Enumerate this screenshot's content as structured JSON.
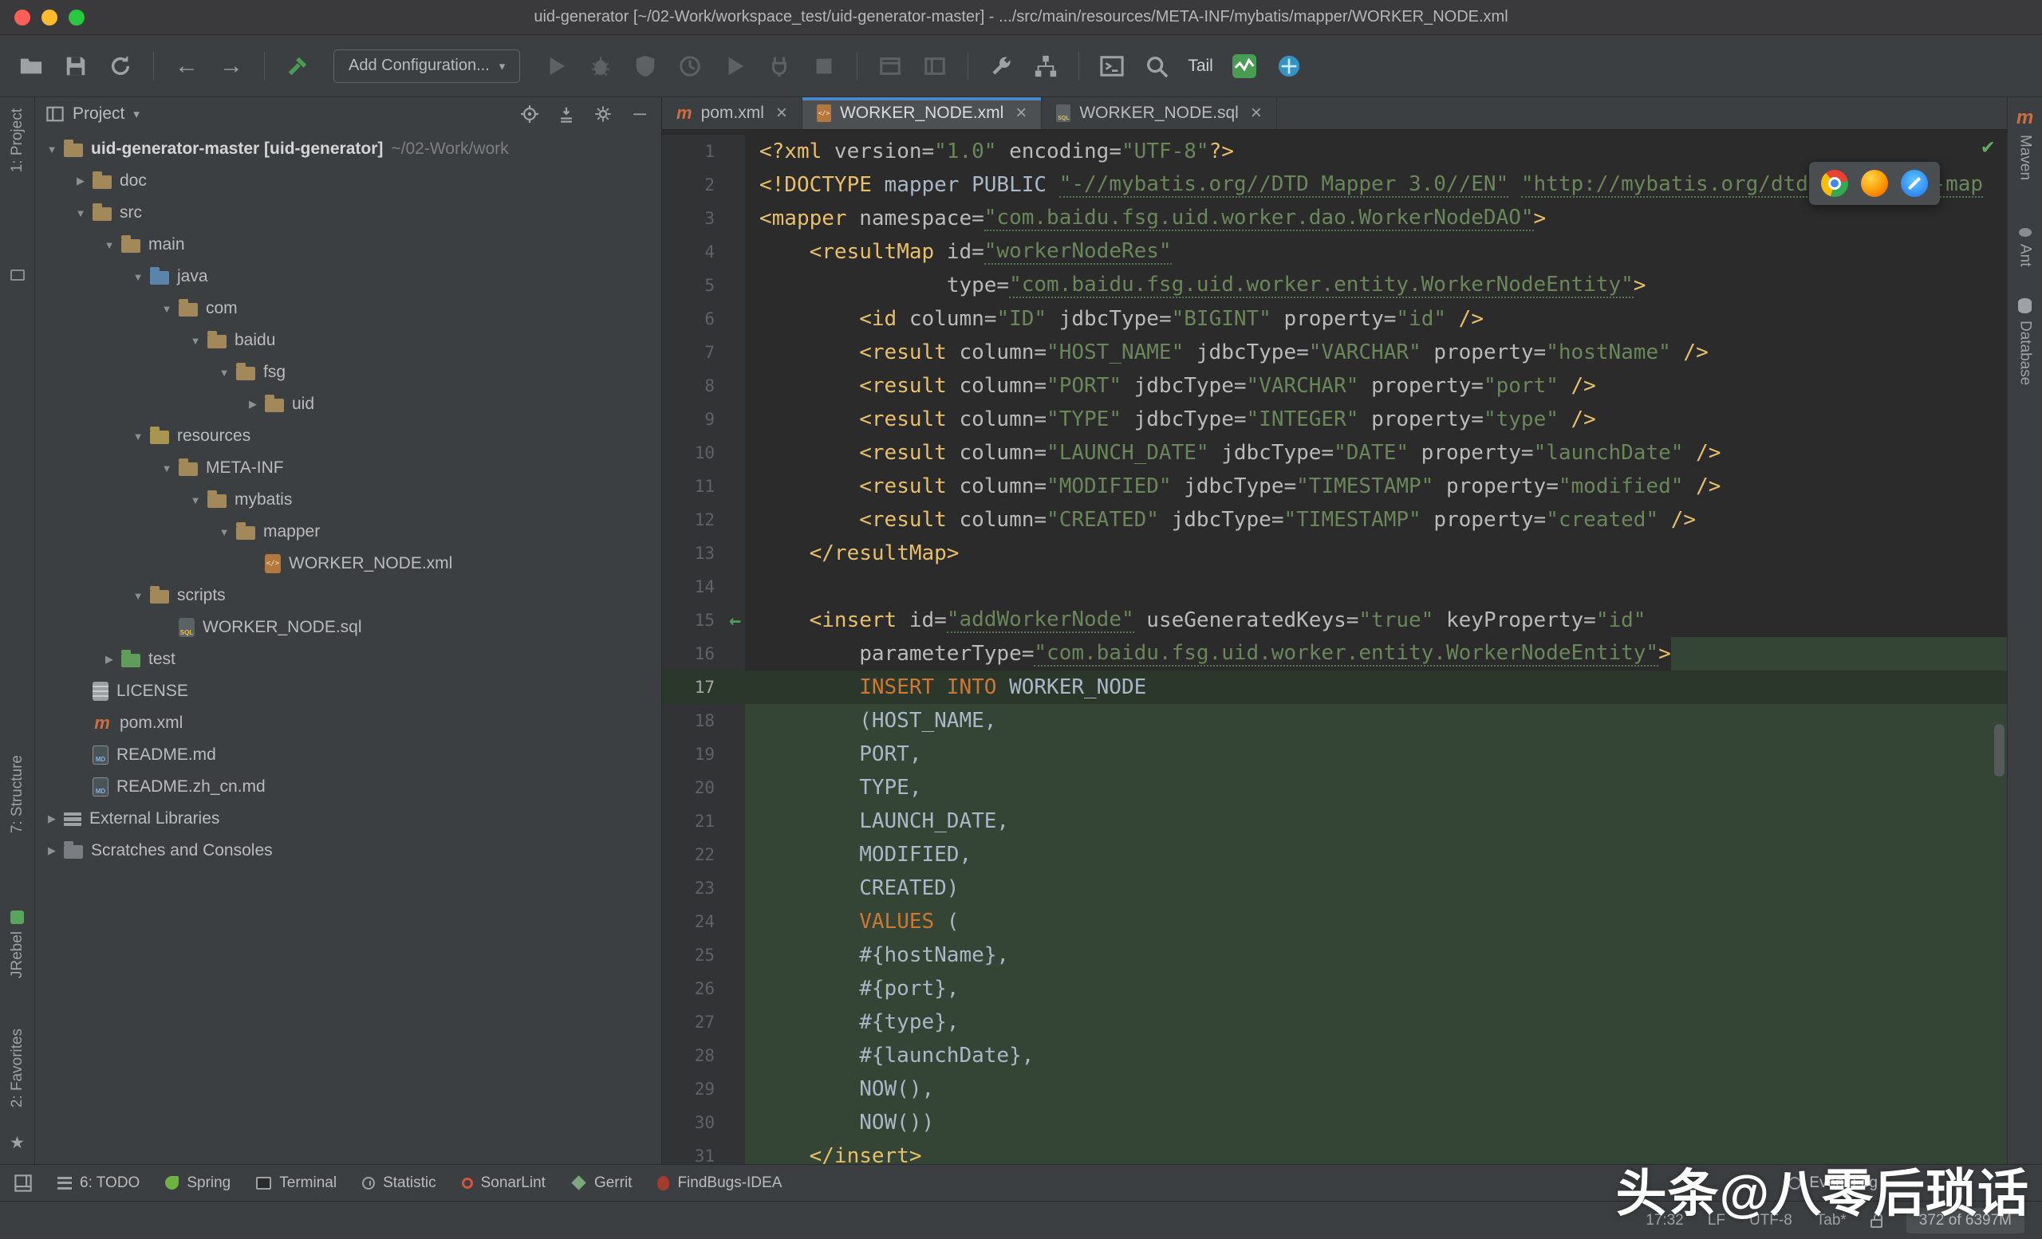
{
  "window_title": "uid-generator [~/02-Work/workspace_test/uid-generator-master] - .../src/main/resources/META-INF/mybatis/mapper/WORKER_NODE.xml",
  "toolbar": {
    "add_configuration": "Add Configuration...",
    "tail": "Tail"
  },
  "stripes": {
    "left": [
      "1: Project",
      "7: Structure",
      "JRebel",
      "2: Favorites"
    ],
    "right": [
      "Maven",
      "Ant",
      "Database"
    ]
  },
  "project_panel": {
    "title": "Project",
    "tree": [
      {
        "label": "uid-generator-master [uid-generator]",
        "suffix": "~/02-Work/work",
        "level": 0,
        "state": "expanded",
        "icon": "folder-project",
        "bold": true
      },
      {
        "label": "doc",
        "level": 1,
        "state": "collapsed",
        "icon": "folder"
      },
      {
        "label": "src",
        "level": 1,
        "state": "expanded",
        "icon": "folder"
      },
      {
        "label": "main",
        "level": 2,
        "state": "expanded",
        "icon": "folder"
      },
      {
        "label": "java",
        "level": 3,
        "state": "expanded",
        "icon": "folder-source"
      },
      {
        "label": "com",
        "level": 4,
        "state": "expanded",
        "icon": "folder"
      },
      {
        "label": "baidu",
        "level": 5,
        "state": "expanded",
        "icon": "folder"
      },
      {
        "label": "fsg",
        "level": 6,
        "state": "expanded",
        "icon": "folder"
      },
      {
        "label": "uid",
        "level": 7,
        "state": "collapsed",
        "icon": "folder"
      },
      {
        "label": "resources",
        "level": 3,
        "state": "expanded",
        "icon": "folder-resources"
      },
      {
        "label": "META-INF",
        "level": 4,
        "state": "expanded",
        "icon": "folder"
      },
      {
        "label": "mybatis",
        "level": 5,
        "state": "expanded",
        "icon": "folder"
      },
      {
        "label": "mapper",
        "level": 6,
        "state": "expanded",
        "icon": "folder"
      },
      {
        "label": "WORKER_NODE.xml",
        "level": 7,
        "state": "leaf",
        "icon": "file-xml"
      },
      {
        "label": "scripts",
        "level": 3,
        "state": "expanded",
        "icon": "folder"
      },
      {
        "label": "WORKER_NODE.sql",
        "level": 4,
        "state": "leaf",
        "icon": "file-sql"
      },
      {
        "label": "test",
        "level": 2,
        "state": "collapsed",
        "icon": "folder-test"
      },
      {
        "label": "LICENSE",
        "level": 1,
        "state": "leaf",
        "icon": "file-text"
      },
      {
        "label": "pom.xml",
        "level": 1,
        "state": "leaf",
        "icon": "file-maven"
      },
      {
        "label": "README.md",
        "level": 1,
        "state": "leaf",
        "icon": "file-md"
      },
      {
        "label": "README.zh_cn.md",
        "level": 1,
        "state": "leaf",
        "icon": "file-md"
      },
      {
        "label": "External Libraries",
        "level": 0,
        "state": "collapsed",
        "icon": "libraries"
      },
      {
        "label": "Scratches and Consoles",
        "level": 0,
        "state": "collapsed",
        "icon": "scratches"
      }
    ]
  },
  "editor": {
    "tabs": [
      {
        "label": "pom.xml",
        "icon": "maven",
        "active": false
      },
      {
        "label": "WORKER_NODE.xml",
        "icon": "xml",
        "active": true
      },
      {
        "label": "WORKER_NODE.sql",
        "icon": "sql",
        "active": false
      }
    ],
    "lines": [
      {
        "n": 1,
        "t": [
          [
            "t",
            "<?xml "
          ],
          [
            "a",
            "version="
          ],
          [
            "s",
            "\"1.0\""
          ],
          [
            "p",
            " "
          ],
          [
            "a",
            "encoding="
          ],
          [
            "s",
            "\"UTF-8\""
          ],
          [
            "t",
            "?>"
          ]
        ]
      },
      {
        "n": 2,
        "t": [
          [
            "t",
            "<!DOCTYPE "
          ],
          [
            "p",
            "mapper PUBLIC "
          ],
          [
            "su",
            "\"-//mybatis.org//DTD Mapper 3.0//EN\""
          ],
          [
            "p",
            " "
          ],
          [
            "su",
            "\"http://mybatis.org/dtd/mybatis-3-map"
          ]
        ]
      },
      {
        "n": 3,
        "t": [
          [
            "t",
            "<mapper "
          ],
          [
            "a",
            "namespace="
          ],
          [
            "su",
            "\"com.baidu.fsg.uid.worker.dao.WorkerNodeDAO\""
          ],
          [
            "t",
            ">"
          ]
        ]
      },
      {
        "n": 4,
        "t": [
          [
            "p",
            "    "
          ],
          [
            "t",
            "<resultMap "
          ],
          [
            "a",
            "id="
          ],
          [
            "su",
            "\"workerNodeRes\""
          ]
        ]
      },
      {
        "n": 5,
        "t": [
          [
            "p",
            "               "
          ],
          [
            "a",
            "type="
          ],
          [
            "su",
            "\"com.baidu.fsg.uid.worker.entity.WorkerNodeEntity\""
          ],
          [
            "t",
            ">"
          ]
        ]
      },
      {
        "n": 6,
        "t": [
          [
            "p",
            "        "
          ],
          [
            "t",
            "<id "
          ],
          [
            "a",
            "column="
          ],
          [
            "s",
            "\"ID\""
          ],
          [
            "p",
            " "
          ],
          [
            "a",
            "jdbcType="
          ],
          [
            "s",
            "\"BIGINT\""
          ],
          [
            "p",
            " "
          ],
          [
            "a",
            "property="
          ],
          [
            "s",
            "\"id\""
          ],
          [
            "p",
            " "
          ],
          [
            "t",
            "/>"
          ]
        ]
      },
      {
        "n": 7,
        "t": [
          [
            "p",
            "        "
          ],
          [
            "t",
            "<result "
          ],
          [
            "a",
            "column="
          ],
          [
            "s",
            "\"HOST_NAME\""
          ],
          [
            "p",
            " "
          ],
          [
            "a",
            "jdbcType="
          ],
          [
            "s",
            "\"VARCHAR\""
          ],
          [
            "p",
            " "
          ],
          [
            "a",
            "property="
          ],
          [
            "s",
            "\"hostName\""
          ],
          [
            "p",
            " "
          ],
          [
            "t",
            "/>"
          ]
        ]
      },
      {
        "n": 8,
        "t": [
          [
            "p",
            "        "
          ],
          [
            "t",
            "<result "
          ],
          [
            "a",
            "column="
          ],
          [
            "s",
            "\"PORT\""
          ],
          [
            "p",
            " "
          ],
          [
            "a",
            "jdbcType="
          ],
          [
            "s",
            "\"VARCHAR\""
          ],
          [
            "p",
            " "
          ],
          [
            "a",
            "property="
          ],
          [
            "s",
            "\"port\""
          ],
          [
            "p",
            " "
          ],
          [
            "t",
            "/>"
          ]
        ]
      },
      {
        "n": 9,
        "t": [
          [
            "p",
            "        "
          ],
          [
            "t",
            "<result "
          ],
          [
            "a",
            "column="
          ],
          [
            "s",
            "\"TYPE\""
          ],
          [
            "p",
            " "
          ],
          [
            "a",
            "jdbcType="
          ],
          [
            "s",
            "\"INTEGER\""
          ],
          [
            "p",
            " "
          ],
          [
            "a",
            "property="
          ],
          [
            "s",
            "\"type\""
          ],
          [
            "p",
            " "
          ],
          [
            "t",
            "/>"
          ]
        ]
      },
      {
        "n": 10,
        "t": [
          [
            "p",
            "        "
          ],
          [
            "t",
            "<result "
          ],
          [
            "a",
            "column="
          ],
          [
            "s",
            "\"LAUNCH_DATE\""
          ],
          [
            "p",
            " "
          ],
          [
            "a",
            "jdbcType="
          ],
          [
            "s",
            "\"DATE\""
          ],
          [
            "p",
            " "
          ],
          [
            "a",
            "property="
          ],
          [
            "s",
            "\"launchDate\""
          ],
          [
            "p",
            " "
          ],
          [
            "t",
            "/>"
          ]
        ]
      },
      {
        "n": 11,
        "t": [
          [
            "p",
            "        "
          ],
          [
            "t",
            "<result "
          ],
          [
            "a",
            "column="
          ],
          [
            "s",
            "\"MODIFIED\""
          ],
          [
            "p",
            " "
          ],
          [
            "a",
            "jdbcType="
          ],
          [
            "s",
            "\"TIMESTAMP\""
          ],
          [
            "p",
            " "
          ],
          [
            "a",
            "property="
          ],
          [
            "s",
            "\"modified\""
          ],
          [
            "p",
            " "
          ],
          [
            "t",
            "/>"
          ]
        ]
      },
      {
        "n": 12,
        "t": [
          [
            "p",
            "        "
          ],
          [
            "t",
            "<result "
          ],
          [
            "a",
            "column="
          ],
          [
            "s",
            "\"CREATED\""
          ],
          [
            "p",
            " "
          ],
          [
            "a",
            "jdbcType="
          ],
          [
            "s",
            "\"TIMESTAMP\""
          ],
          [
            "p",
            " "
          ],
          [
            "a",
            "property="
          ],
          [
            "s",
            "\"created\""
          ],
          [
            "p",
            " "
          ],
          [
            "t",
            "/>"
          ]
        ]
      },
      {
        "n": 13,
        "t": [
          [
            "p",
            "    "
          ],
          [
            "t",
            "</resultMap>"
          ]
        ]
      },
      {
        "n": 14,
        "t": []
      },
      {
        "n": 15,
        "g": "arrow",
        "t": [
          [
            "p",
            "    "
          ],
          [
            "t",
            "<insert "
          ],
          [
            "a",
            "id="
          ],
          [
            "su",
            "\"addWorkerNode\""
          ],
          [
            "p",
            " "
          ],
          [
            "a",
            "useGeneratedKeys="
          ],
          [
            "s",
            "\"true\""
          ],
          [
            "p",
            " "
          ],
          [
            "a",
            "keyProperty="
          ],
          [
            "s",
            "\"id\""
          ]
        ]
      },
      {
        "n": 16,
        "bg": "after",
        "t": [
          [
            "p",
            "        "
          ],
          [
            "a",
            "parameterType="
          ],
          [
            "su",
            "\"com.baidu.fsg.uid.worker.entity.WorkerNodeEntity\""
          ],
          [
            "t",
            ">"
          ]
        ]
      },
      {
        "n": 17,
        "bg": "caret",
        "t": [
          [
            "p",
            "        "
          ],
          [
            "k",
            "INSERT INTO"
          ],
          [
            "p",
            " WORKER_NODE"
          ]
        ]
      },
      {
        "n": 18,
        "bg": "inj",
        "t": [
          [
            "p",
            "        (HOST_NAME,"
          ]
        ]
      },
      {
        "n": 19,
        "bg": "inj",
        "t": [
          [
            "p",
            "        PORT,"
          ]
        ]
      },
      {
        "n": 20,
        "bg": "inj",
        "t": [
          [
            "p",
            "        TYPE,"
          ]
        ]
      },
      {
        "n": 21,
        "bg": "inj",
        "t": [
          [
            "p",
            "        LAUNCH_DATE,"
          ]
        ]
      },
      {
        "n": 22,
        "bg": "inj",
        "t": [
          [
            "p",
            "        MODIFIED,"
          ]
        ]
      },
      {
        "n": 23,
        "bg": "inj",
        "t": [
          [
            "p",
            "        CREATED)"
          ]
        ]
      },
      {
        "n": 24,
        "bg": "inj",
        "t": [
          [
            "p",
            "        "
          ],
          [
            "k",
            "VALUES"
          ],
          [
            "p",
            " ("
          ]
        ]
      },
      {
        "n": 25,
        "bg": "inj",
        "t": [
          [
            "p",
            "        #{hostName},"
          ]
        ]
      },
      {
        "n": 26,
        "bg": "inj",
        "t": [
          [
            "p",
            "        #{port},"
          ]
        ]
      },
      {
        "n": 27,
        "bg": "inj",
        "t": [
          [
            "p",
            "        #{type},"
          ]
        ]
      },
      {
        "n": 28,
        "bg": "inj",
        "t": [
          [
            "p",
            "        #{launchDate},"
          ]
        ]
      },
      {
        "n": 29,
        "bg": "inj",
        "t": [
          [
            "p",
            "        NOW(),"
          ]
        ]
      },
      {
        "n": 30,
        "bg": "inj",
        "t": [
          [
            "p",
            "        NOW())"
          ]
        ]
      },
      {
        "n": 31,
        "bg": "inj",
        "t": [
          [
            "p",
            "    "
          ],
          [
            "t",
            "</insert>"
          ]
        ]
      }
    ]
  },
  "browser_popup": {
    "icons": [
      "chrome",
      "firefox",
      "safari"
    ]
  },
  "bottom_bar": {
    "left": [
      {
        "label": "6: TODO",
        "icon": "todo"
      },
      {
        "label": "Spring",
        "icon": "spring"
      },
      {
        "label": "Terminal",
        "icon": "terminal"
      },
      {
        "label": "Statistic",
        "icon": "statistic"
      },
      {
        "label": "SonarLint",
        "icon": "sonarlint"
      },
      {
        "label": "Gerrit",
        "icon": "gerrit"
      },
      {
        "label": "FindBugs-IDEA",
        "icon": "findbugs"
      }
    ],
    "right": [
      {
        "label": "Event Log",
        "icon": "event-log"
      }
    ]
  },
  "status_bar": {
    "time": "17:32",
    "line_separator": "LF",
    "encoding": "UTF-8",
    "indent": "Tab*",
    "memory": "372 of 6397M"
  },
  "watermark": "头条@八零后琐话"
}
